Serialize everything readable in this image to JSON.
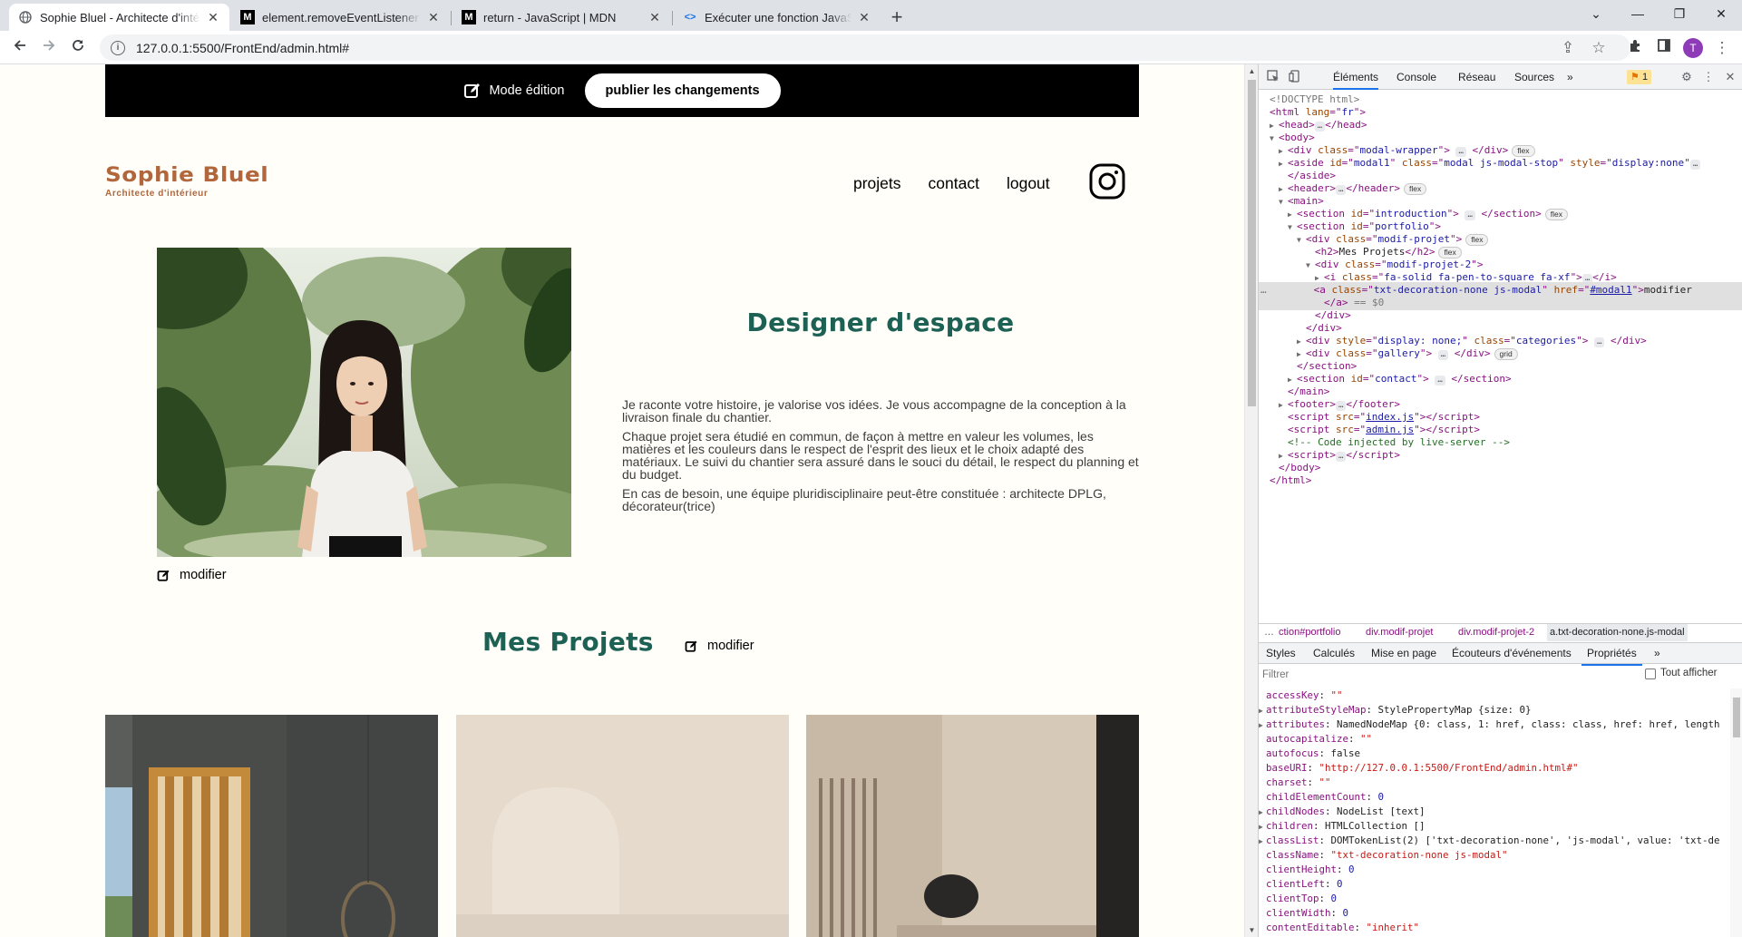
{
  "browser": {
    "tabs": [
      {
        "title": "Sophie Bluel - Architecte d'intérieur",
        "favicon": "globe-icon",
        "active": true
      },
      {
        "title": "element.removeEventListener - R",
        "favicon": "mdn-icon",
        "active": false
      },
      {
        "title": "return - JavaScript | MDN",
        "favicon": "mdn-icon",
        "active": false
      },
      {
        "title": "Exécuter une fonction JavaScript",
        "favicon": "code-icon",
        "active": false
      }
    ],
    "url": "127.0.0.1:5500/FrontEnd/admin.html#",
    "profile_initial": "T"
  },
  "page": {
    "edit_bar": {
      "mode_label": "Mode édition",
      "publish_label": "publier les changements"
    },
    "logo": {
      "name": "Sophie Bluel",
      "subtitle": "Architecte d'intérieur"
    },
    "nav": [
      "projets",
      "contact",
      "logout"
    ],
    "intro": {
      "title": "Designer d'espace",
      "paragraphs": [
        "Je raconte votre histoire, je valorise vos idées. Je vous accompagne de la conception à la livraison finale du chantier.",
        "Chaque projet sera étudié en commun, de façon à mettre en valeur les volumes, les matières et les couleurs dans le respect de l'esprit des lieux et le choix adapté des matériaux. Le suivi du chantier sera assuré dans le souci du détail, le respect du planning et du budget.",
        "En cas de besoin, une équipe pluridisciplinaire peut-être constituée : architecte DPLG, décorateur(trice)"
      ]
    },
    "modify_label": "modifier",
    "projects_title": "Mes Projets",
    "colors": {
      "accent_green": "#1d6154",
      "brand_brown": "#b1663c",
      "background": "#fffef8"
    }
  },
  "devtools": {
    "tabs": [
      "Éléments",
      "Console",
      "Réseau",
      "Sources"
    ],
    "issues_count": "1",
    "dom": {
      "doctype": "<!DOCTYPE html>",
      "html_lang": "fr",
      "modal_wrapper_class": "modal-wrapper",
      "aside_id": "modal1",
      "aside_class": "modal js-modal-stop",
      "aside_style": "display:none",
      "intro_id": "introduction",
      "portfolio_id": "portfolio",
      "modif_projet": "modif-projet",
      "h2_text": "Mes Projets",
      "modif_projet_2": "modif-projet-2",
      "i_class": "fa-solid fa-pen-to-square fa-xf",
      "a_class": "txt-decoration-none js-modal",
      "a_href": "#modal1",
      "a_text": "modifier",
      "dollar_zero": "== $0",
      "categories_style": "display: none;",
      "categories_class": "categories",
      "gallery_class": "gallery",
      "contact_id": "contact",
      "script1": "index.js",
      "script2": "admin.js",
      "comment": "<!-- Code injected by live-server -->"
    },
    "breadcrumbs": [
      "…",
      "ction#portfolio",
      "div.modif-projet",
      "div.modif-projet-2",
      "a.txt-decoration-none.js-modal"
    ],
    "sub_tabs": [
      "Styles",
      "Calculés",
      "Mise en page",
      "Écouteurs d'événements",
      "Propriétés"
    ],
    "filter_placeholder": "Filtrer",
    "show_all_label": "Tout afficher",
    "properties": [
      {
        "k": "accessKey",
        "v": "\"\"",
        "t": "s"
      },
      {
        "k": "attributeStyleMap",
        "v": "StylePropertyMap {size: 0}",
        "t": "o",
        "exp": true
      },
      {
        "k": "attributes",
        "v": "NamedNodeMap {0: class, 1: href, class: class, href: href, length",
        "t": "o",
        "exp": true
      },
      {
        "k": "autocapitalize",
        "v": "\"\"",
        "t": "s"
      },
      {
        "k": "autofocus",
        "v": "false",
        "t": "o"
      },
      {
        "k": "baseURI",
        "v": "\"http://127.0.0.1:5500/FrontEnd/admin.html#\"",
        "t": "s"
      },
      {
        "k": "charset",
        "v": "\"\"",
        "t": "s"
      },
      {
        "k": "childElementCount",
        "v": "0",
        "t": "n"
      },
      {
        "k": "childNodes",
        "v": "NodeList [text]",
        "t": "o",
        "exp": true
      },
      {
        "k": "children",
        "v": "HTMLCollection []",
        "t": "o",
        "exp": true
      },
      {
        "k": "classList",
        "v": "DOMTokenList(2) ['txt-decoration-none', 'js-modal', value: 'txt-de",
        "t": "o",
        "exp": true
      },
      {
        "k": "className",
        "v": "\"txt-decoration-none js-modal\"",
        "t": "s"
      },
      {
        "k": "clientHeight",
        "v": "0",
        "t": "n"
      },
      {
        "k": "clientLeft",
        "v": "0",
        "t": "n"
      },
      {
        "k": "clientTop",
        "v": "0",
        "t": "n"
      },
      {
        "k": "clientWidth",
        "v": "0",
        "t": "n"
      },
      {
        "k": "contentEditable",
        "v": "\"inherit\"",
        "t": "s"
      }
    ]
  }
}
